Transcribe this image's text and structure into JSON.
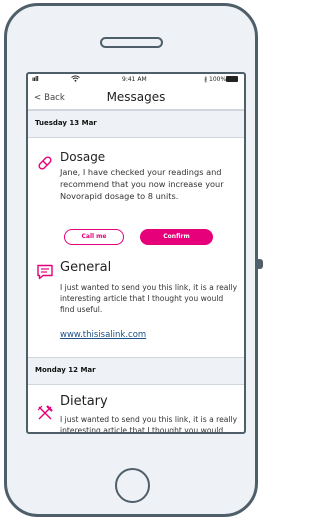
{
  "status_bar": {
    "signal": "ııll",
    "wifi_icon": "wifi-icon",
    "time": "9:41 AM",
    "bluetooth": "∦",
    "battery_percent": "100%"
  },
  "nav": {
    "back_label": "Back",
    "title": "Messages"
  },
  "sections": [
    {
      "date": "Tuesday 13 Mar"
    },
    {
      "date": "Monday 12 Mar"
    }
  ],
  "messages": [
    {
      "icon": "pill-icon",
      "title": "Dosage",
      "body": "Jane, I have checked your readings and recommend that you now increase your Novorapid dosage to 8 units.",
      "actions": {
        "secondary": "Call me",
        "primary": "Confirm"
      }
    },
    {
      "icon": "chat-icon",
      "title": "General",
      "body": "I just wanted to send you this link, it is a really interesting article that I thought you would find useful.",
      "link": "www.thisisalink.com"
    },
    {
      "icon": "utensils-icon",
      "title": "Dietary",
      "body": "I just wanted to send you this link, it is a really interesting article that I thought you would find useful."
    }
  ],
  "colors": {
    "accent": "#e6007a",
    "frame": "#4f5f6a",
    "link": "#1b4f8a",
    "section_bg": "#eef2f6"
  }
}
